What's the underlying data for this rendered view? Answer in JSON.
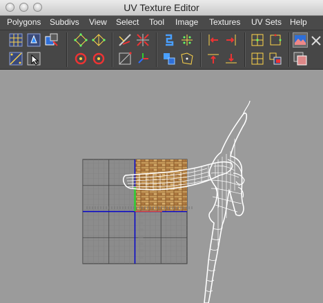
{
  "window": {
    "title": "UV Texture Editor"
  },
  "menu": {
    "items": [
      "Polygons",
      "Subdivs",
      "View",
      "Select",
      "Tool",
      "Image",
      "Textures",
      "UV Sets",
      "Help"
    ]
  },
  "toolbar": {
    "row1": [
      "uv-grid-icon",
      "move-uv-icon",
      "scale-uv-icon",
      "flip-u-icon",
      "flip-v-icon",
      "cut-uv-icon",
      "sew-uv-icon",
      "unfold-icon",
      "layout-icon",
      "align-left-icon",
      "align-right-icon",
      "snapshot-icon",
      "tile-icon",
      "texture-display-icon"
    ],
    "row2": [
      "grid-toggle-icon",
      "select-uv-icon",
      "rotate-ccw-icon",
      "rotate-cw-icon",
      "normalize-icon",
      "axis-icon",
      "split-uv-icon",
      "relax-icon",
      "align-top-icon",
      "align-bottom-icon",
      "unitize-icon",
      "isolate-icon",
      "image-range-icon"
    ]
  },
  "colors": {
    "menubar": "#4a4a4a",
    "toolbar": "#474747",
    "viewport": "#9b9b9b",
    "uv_axis_u": "#0000cc",
    "uv_axis_v": "#3cc43c",
    "wireframe": "#ffffff"
  }
}
